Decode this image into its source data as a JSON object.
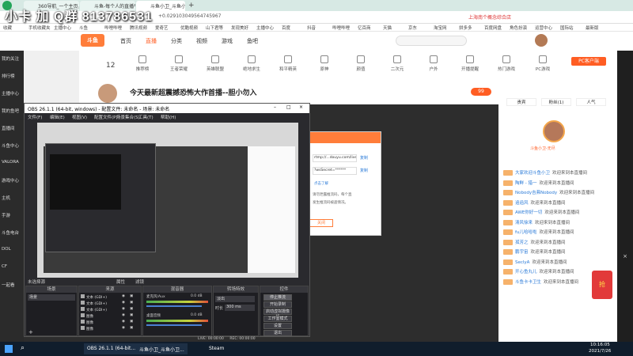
{
  "browser": {
    "tabs": [
      {
        "label": "360导航_一个主页，整个世界"
      },
      {
        "label": "斗鱼-每个人的直播平台"
      },
      {
        "label": "斗鱼小卫_斗鱼小卫直播间(1388"
      }
    ],
    "url": "斗鱼小卫_斗鱼小卫直播间(1388...",
    "url_fragment": "+0.029103049564745967",
    "bookmarks": [
      "收藏",
      "手机收藏夹",
      "主播中心",
      "斗鱼",
      "哔哩哔哩",
      "腾讯视频",
      "爱奇艺",
      "优酷视频",
      "山下君等",
      "发现美好",
      "主播中心",
      "百度",
      "抖音",
      "哔哩哔哩",
      "亿百商",
      "天猫",
      "京东",
      "淘宝网",
      "拼多多",
      "百度网盘",
      "角色扮演",
      "运营中心",
      "国际站",
      "最新版"
    ],
    "notice": "上海南个概念综合店"
  },
  "overlay_text": "小卡 加 Q群 813786531",
  "site": {
    "nav": [
      "首页",
      "直播",
      "分类",
      "视频",
      "游戏",
      "鱼吧"
    ],
    "stream_count": "12",
    "categories": [
      "推荐榜",
      "王者荣耀",
      "英雄联盟",
      "绝地求生",
      "和平精英",
      "原神",
      "颜值",
      "二次元",
      "户外",
      "开播提醒",
      "热门游戏",
      "PC游戏"
    ],
    "stream_title": "今天最新超震撼恐怖大作首播--胆小勿入",
    "like_count": "99",
    "follow_label": "关注主播",
    "sidebar_items": [
      "我的关注",
      "排行榜",
      "主播中心",
      "我的鱼吧",
      "直播间",
      "斗鱼中心",
      "VALORA",
      "游戏中心",
      "主机",
      "手游",
      "斗鱼电台",
      "DOL",
      "CF",
      "一起看"
    ],
    "right_tabs": [
      "贵宾",
      "粉丝(1)",
      "人气"
    ],
    "anchor_name": "斗鱼小卫-无尽",
    "chat": [
      {
        "name": "大家欢迎斗鱼小卫",
        "text": "欢迎来到本直播间"
      },
      {
        "name": "陶鲜 - 猎一",
        "text": "欢迎来到本直播间"
      },
      {
        "name": "Nobody吉弗Nobody",
        "text": "欢迎来到本直播间"
      },
      {
        "name": "追追风",
        "text": "欢迎来到本直播间"
      },
      {
        "name": "AWE你好一切",
        "text": "欢迎来到本直播间"
      },
      {
        "name": "清风徐来",
        "text": "欢迎来到本直播间"
      },
      {
        "name": "fu儿哈哈啦",
        "text": "欢迎来到本直播间"
      },
      {
        "name": "孤芳之",
        "text": "欢迎来到本直播间"
      },
      {
        "name": "鹏宇宙",
        "text": "欢迎来到本直播间"
      },
      {
        "name": "SeclyA",
        "text": "欢迎来到本直播间"
      },
      {
        "name": "开心鱼丸儿",
        "text": "欢迎来到本直播间"
      },
      {
        "name": "斗鱼卡卡卫生",
        "text": "欢迎来到本直播间"
      }
    ],
    "pc_client": "PC客户端",
    "redpacket": "抢"
  },
  "dialog": {
    "url": "rtmp://...douyu.com/live",
    "copy": "复制",
    "key": "?wsSecret=******",
    "copy2": "复制",
    "hint1": "请勿泄露推流码，每个直",
    "hint2": "发生推流码被盗情况。",
    "button": "关闭",
    "link": "点击了解"
  },
  "obs": {
    "title": "OBS 26.1.1 (64-bit, windows) - 配置文件: 未命名 - 场景: 未命名",
    "menu": [
      "文件(F)",
      "编辑(E)",
      "视图(V)",
      "配置文件(P)",
      "场景集合(S)",
      "工具(T)",
      "帮助(H)"
    ],
    "source_none": "未选择源",
    "props": "属性",
    "filters": "滤镜",
    "docks": {
      "scenes": "场景",
      "sources": "来源",
      "mixer": "混音器",
      "transitions": "转场特效",
      "controls": "控件"
    },
    "scene_item": "场景",
    "source_items": [
      "文本 (GDI+)",
      "文本 (GDI+)",
      "文本 (GDI+)",
      "图像",
      "图像",
      "图像"
    ],
    "mixer_items": [
      {
        "name": "麦克风/Aux",
        "level": "0.0 dB"
      },
      {
        "name": "桌面音频",
        "level": "0.0 dB"
      }
    ],
    "transition": "淡出",
    "duration_label": "时长",
    "duration": "300 ms",
    "controls": [
      "停止推流",
      "开始录制",
      "启动虚拟摄像机",
      "工作室模式",
      "设置",
      "退出"
    ],
    "status": {
      "live": "LIVE: 00:00:00",
      "rec": "REC: 00:00:00",
      "cpu": "CPU: 2.8%, 60.00 fps",
      "kbs": "kb/s: 0"
    }
  },
  "taskbar": {
    "items": [
      "OBS 26.1.1 (64-bit...",
      "斗鱼小卫_斗鱼小卫...",
      "Steam"
    ],
    "time": "10:16:05",
    "date": "2021/7/26"
  },
  "colors": {
    "douyu_orange": "#ff5d23",
    "obs_bg": "#2a2a2e",
    "taskbar": "#101d2c"
  }
}
